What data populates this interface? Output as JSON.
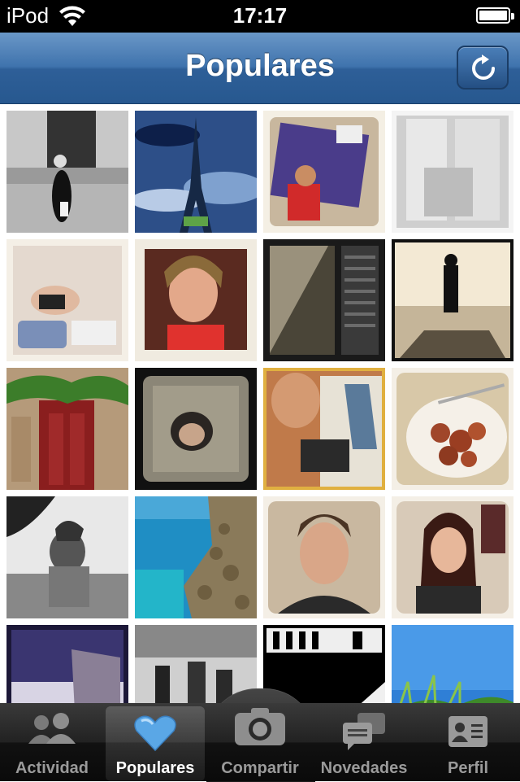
{
  "status_bar": {
    "carrier": "iPod",
    "time": "17:17"
  },
  "nav": {
    "title": "Populares",
    "refresh_icon": "refresh-icon"
  },
  "tabs": [
    {
      "label": "Actividad",
      "icon": "people-icon",
      "active": false
    },
    {
      "label": "Populares",
      "icon": "heart-icon",
      "active": true
    },
    {
      "label": "Compartir",
      "icon": "camera-icon",
      "active": false
    },
    {
      "label": "Novedades",
      "icon": "chat-bubbles-icon",
      "active": false
    },
    {
      "label": "Perfil",
      "icon": "profile-card-icon",
      "active": false
    }
  ],
  "colors": {
    "nav_blue": "#3f73ad",
    "heart_blue": "#5aa7e6",
    "tab_inactive": "#9a9a9a"
  },
  "photos": [
    {
      "desc": "street-woman-bw"
    },
    {
      "desc": "eiffel-tower-blue-sky"
    },
    {
      "desc": "boy-red-shirt-sign"
    },
    {
      "desc": "mcdonalds-cups"
    },
    {
      "desc": "woman-suitcase"
    },
    {
      "desc": "woman-portrait-red"
    },
    {
      "desc": "window-shutter"
    },
    {
      "desc": "man-on-pier"
    },
    {
      "desc": "red-door-ivy"
    },
    {
      "desc": "man-in-box"
    },
    {
      "desc": "tattooed-woman"
    },
    {
      "desc": "meatballs-plate"
    },
    {
      "desc": "bw-woman-beach"
    },
    {
      "desc": "rocks-blue-sea"
    },
    {
      "desc": "man-portrait"
    },
    {
      "desc": "woman-bangs"
    },
    {
      "desc": "tower-purple-sky"
    },
    {
      "desc": "street-people-bw"
    },
    {
      "desc": "dark-window"
    },
    {
      "desc": "grass-blue-sky"
    }
  ]
}
